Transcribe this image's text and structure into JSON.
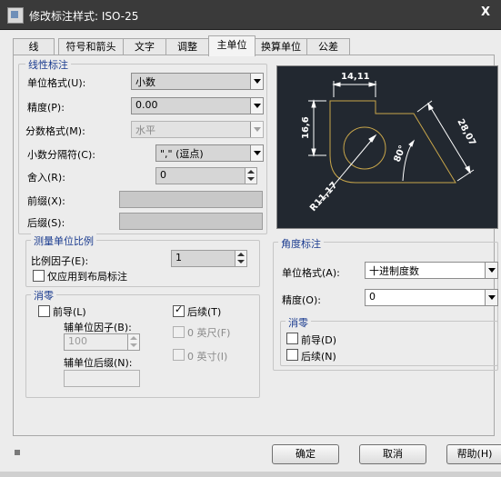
{
  "window": {
    "title": "修改标注样式: ISO-25",
    "close_label": "X"
  },
  "tabs": [
    {
      "label": "线"
    },
    {
      "label": "符号和箭头"
    },
    {
      "label": "文字"
    },
    {
      "label": "调整"
    },
    {
      "label": "主单位",
      "active": true
    },
    {
      "label": "换算单位"
    },
    {
      "label": "公差"
    }
  ],
  "linear": {
    "title": "线性标注",
    "unit_format_label": "单位格式(U):",
    "unit_format_value": "小数",
    "precision_label": "精度(P):",
    "precision_value": "0.00",
    "fraction_format_label": "分数格式(M):",
    "fraction_format_value": "水平",
    "decimal_sep_label": "小数分隔符(C):",
    "decimal_sep_value": "\",\"  (逗点)",
    "round_label": "舍入(R):",
    "round_value": "0",
    "prefix_label": "前缀(X):",
    "prefix_value": "",
    "suffix_label": "后缀(S):",
    "suffix_value": ""
  },
  "scale": {
    "title": "测量单位比例",
    "factor_label": "比例因子(E):",
    "factor_value": "1",
    "layout_only_label": "仅应用到布局标注",
    "layout_only_checked": false
  },
  "zero_linear": {
    "title": "消零",
    "leading_label": "前导(L)",
    "leading_checked": false,
    "trailing_label": "后续(T)",
    "trailing_checked": true,
    "sub_factor_label": "辅单位因子(B):",
    "sub_factor_value": "100",
    "sub_suffix_label": "辅单位后缀(N):",
    "sub_suffix_value": "",
    "feet_label": "0 英尺(F)",
    "inches_label": "0 英寸(I)"
  },
  "angular": {
    "title": "角度标注",
    "unit_format_label": "单位格式(A):",
    "unit_format_value": "十进制度数",
    "precision_label": "精度(O):",
    "precision_value": "0"
  },
  "zero_angular": {
    "title": "消零",
    "leading_label": "前导(D)",
    "leading_checked": false,
    "trailing_label": "后续(N)",
    "trailing_checked": false
  },
  "preview": {
    "dim_top": "14,11",
    "dim_left": "16,6",
    "dim_right": "28,07",
    "dim_angle": "80°",
    "dim_radius": "R11,17",
    "colors": {
      "bg": "#222830",
      "line": "#ffffff",
      "geometry": "#c8a64a"
    }
  },
  "buttons": {
    "ok": "确定",
    "cancel": "取消",
    "help": "帮助(H)"
  }
}
